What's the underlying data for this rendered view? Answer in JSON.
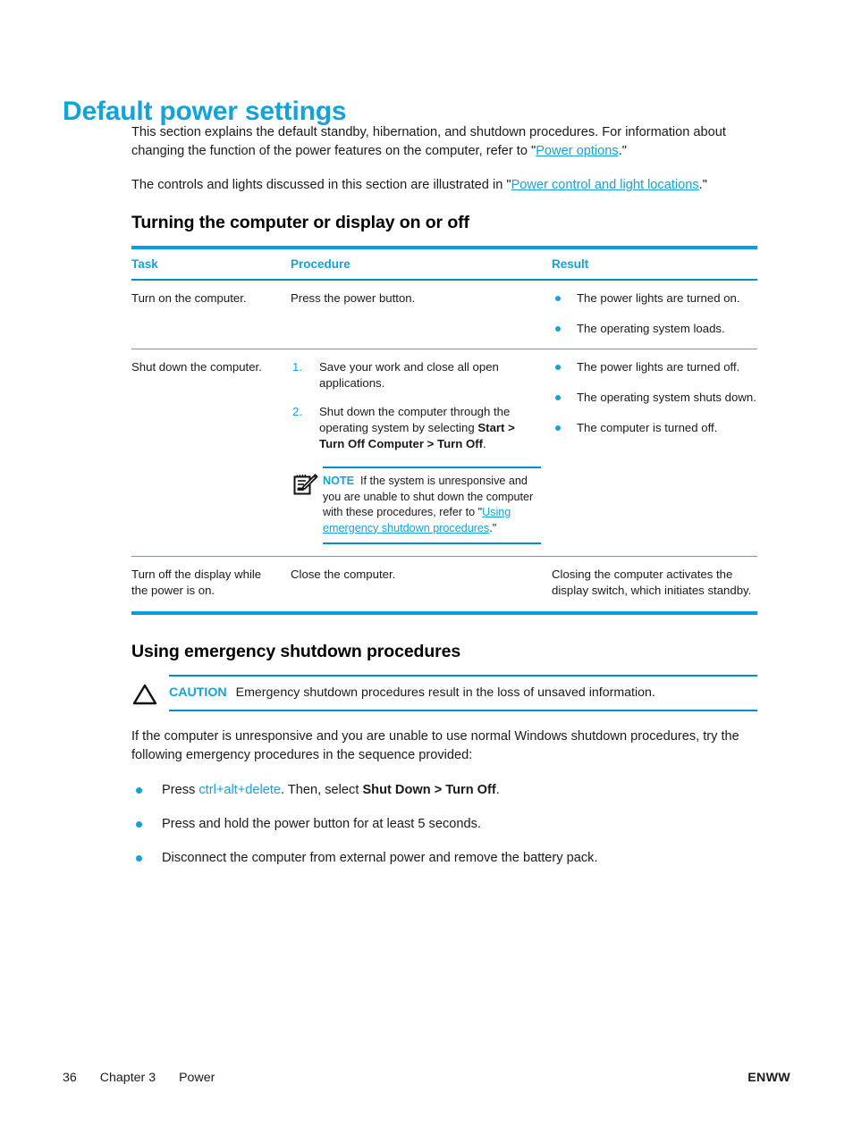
{
  "document": {
    "title": "Default power settings",
    "intro_paragraphs": [
      {
        "before": "This section explains the default standby, hibernation, and shutdown procedures. For information about changing the function of the power features on the computer, refer to \"",
        "link": "Power options",
        "after": ".\""
      },
      {
        "before": "The controls and lights discussed in this section are illustrated in \"",
        "link": "Power control and light locations",
        "after": ".\""
      }
    ]
  },
  "section_table": {
    "heading": "Turning the computer or display on or off",
    "columns": [
      "Task",
      "Procedure",
      "Result"
    ],
    "rows": [
      {
        "task": "Turn on the computer.",
        "procedure_text": "Press the power button.",
        "results": [
          "The power lights are turned on.",
          "The operating system loads."
        ]
      },
      {
        "task": "Shut down the computer.",
        "steps": [
          {
            "num": "1.",
            "text": "Save your work and close all open applications."
          },
          {
            "num": "2.",
            "text_before": "Shut down the computer through the operating system by selecting ",
            "bold": "Start > Turn Off Computer > Turn Off",
            "text_after": "."
          }
        ],
        "note": {
          "icon": "note-pad-pencil-icon",
          "label": "NOTE",
          "text_before": "If the system is unresponsive and you are unable to shut down the computer with these procedures, refer to \"",
          "link": "Using emergency shutdown procedures",
          "text_after": ".\""
        },
        "results": [
          "The power lights are turned off.",
          "The operating system shuts down.",
          "The computer is turned off."
        ]
      },
      {
        "task": "Turn off the display while the power is on.",
        "procedure_text": "Close the computer.",
        "result_plain": "Closing the computer activates the display switch, which initiates standby."
      }
    ]
  },
  "emergency_section": {
    "heading": "Using emergency shutdown procedures",
    "caution": {
      "icon": "warning-triangle-icon",
      "label": "CAUTION",
      "text": "Emergency shutdown procedures result in the loss of unsaved information."
    },
    "intro": "If the computer is unresponsive and you are unable to use normal Windows shutdown procedures, try the following emergency procedures in the sequence provided:",
    "bullets": [
      {
        "before": "Press ",
        "key": "ctrl+alt+delete",
        "middle": ". Then, select ",
        "bold": "Shut Down > Turn Off",
        "after": "."
      },
      {
        "plain": "Press and hold the power button for at least 5 seconds."
      },
      {
        "plain": "Disconnect the computer from external power and remove the battery pack."
      }
    ]
  },
  "footer": {
    "page_number": "36",
    "chapter": "Chapter 3",
    "chapter_title": "Power",
    "publication_code": "ENWW"
  },
  "colors": {
    "accent_cyan": "#12A3DB",
    "rule_cyan": "#00A0DC",
    "text_black": "#1a1a1a",
    "row_rule": "#7d95a5"
  }
}
